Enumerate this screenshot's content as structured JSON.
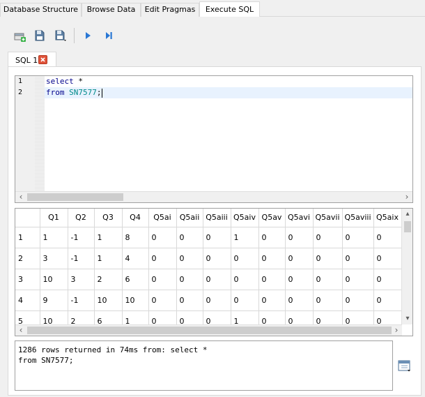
{
  "top_tabs": [
    {
      "label": "Database Structure"
    },
    {
      "label": "Browse Data"
    },
    {
      "label": "Edit Pragmas"
    },
    {
      "label": "Execute SQL"
    }
  ],
  "toolbar": {
    "icons": [
      "open-tab-icon",
      "open-sql-file-icon",
      "save-sql-file-icon",
      "execute-all-icon",
      "execute-line-icon"
    ]
  },
  "sql_tab": {
    "label": "SQL 1"
  },
  "editor": {
    "line_numbers": [
      "1",
      "2"
    ],
    "line1": {
      "kw": "select",
      "rest": " *"
    },
    "line2": {
      "kw": "from",
      "ident": "SN7577",
      "end": ";"
    }
  },
  "grid": {
    "columns": [
      "Q1",
      "Q2",
      "Q3",
      "Q4",
      "Q5ai",
      "Q5aii",
      "Q5aiii",
      "Q5aiv",
      "Q5av",
      "Q5avi",
      "Q5avii",
      "Q5aviii",
      "Q5aix"
    ],
    "rows": [
      {
        "num": "1",
        "cells": [
          "1",
          "-1",
          "1",
          "8",
          "0",
          "0",
          "0",
          "1",
          "0",
          "0",
          "0",
          "0",
          "0"
        ]
      },
      {
        "num": "2",
        "cells": [
          "3",
          "-1",
          "1",
          "4",
          "0",
          "0",
          "0",
          "0",
          "0",
          "0",
          "0",
          "0",
          "0"
        ]
      },
      {
        "num": "3",
        "cells": [
          "10",
          "3",
          "2",
          "6",
          "0",
          "0",
          "0",
          "0",
          "0",
          "0",
          "0",
          "0",
          "0"
        ]
      },
      {
        "num": "4",
        "cells": [
          "9",
          "-1",
          "10",
          "10",
          "0",
          "0",
          "0",
          "0",
          "0",
          "0",
          "0",
          "0",
          "0"
        ]
      },
      {
        "num": "5",
        "cells": [
          "10",
          "2",
          "6",
          "1",
          "0",
          "0",
          "0",
          "1",
          "0",
          "0",
          "0",
          "0",
          "0"
        ]
      }
    ]
  },
  "message": "1286 rows returned in 74ms from: select *\nfrom SN7577;"
}
